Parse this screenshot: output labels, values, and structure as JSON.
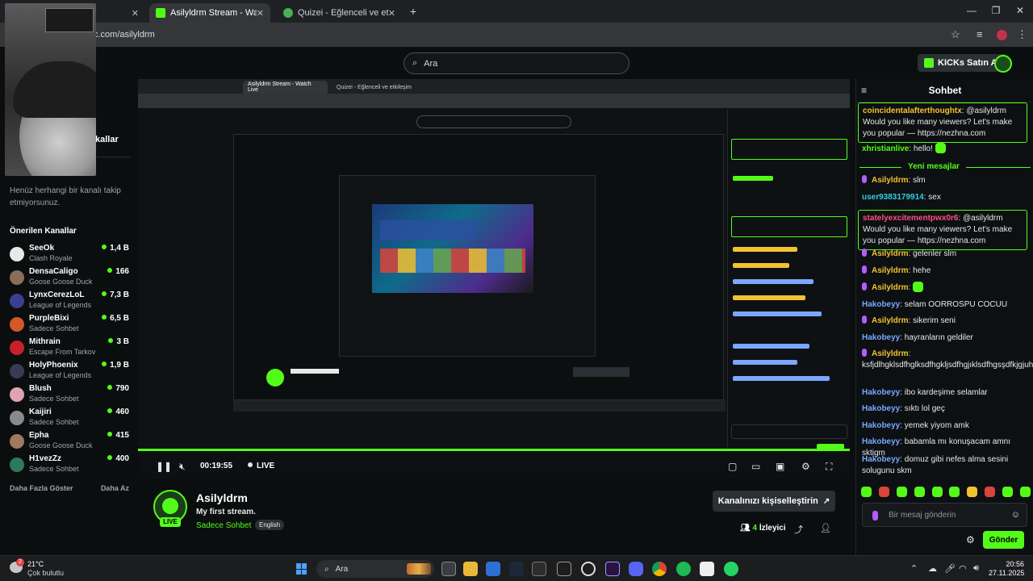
{
  "browser": {
    "tabs": [
      {
        "label": "",
        "active": false
      },
      {
        "label": "Asilyldrm Stream - Watch Live o",
        "active": true
      },
      {
        "label": "Quizei - Eğlenceli ve etkileşiml",
        "active": false
      }
    ],
    "url": "c.com/asilyldrm"
  },
  "header": {
    "search_placeholder": "Ara",
    "kicks_button": "KICKs Satın Al"
  },
  "sidebar": {
    "followed_title": "kallar",
    "no_follow_text": "Henüz herhangi bir kanalı takip etmiyorsunuz.",
    "recommended_title": "Önerilen Kanallar",
    "channels": [
      {
        "name": "SeeOk",
        "category": "Clash Royale",
        "viewers": "1,4 B",
        "color": "#e8e8e8"
      },
      {
        "name": "DensaCaligo",
        "category": "Goose Goose Duck",
        "viewers": "166",
        "color": "#8a6d5a"
      },
      {
        "name": "LynxCerezLoL",
        "category": "League of Legends",
        "viewers": "7,3 B",
        "color": "#3b3f8f"
      },
      {
        "name": "PurpleBixi",
        "category": "Sadece Sohbet",
        "viewers": "6,5 B",
        "color": "#d4572a"
      },
      {
        "name": "Mithrain",
        "category": "Escape From Tarkov",
        "viewers": "3 B",
        "color": "#c8202a"
      },
      {
        "name": "HolyPhoenix",
        "category": "League of Legends",
        "viewers": "1,9 B",
        "color": "#3a3a55"
      },
      {
        "name": "Blush",
        "category": "Sadece Sohbet",
        "viewers": "790",
        "color": "#e0a3b0"
      },
      {
        "name": "Kaijiri",
        "category": "Sadece Sohbet",
        "viewers": "460",
        "color": "#8a8a8a"
      },
      {
        "name": "Epha",
        "category": "Goose Goose Duck",
        "viewers": "415",
        "color": "#a07a60"
      },
      {
        "name": "H1vezZz",
        "category": "Sadece Sohbet",
        "viewers": "400",
        "color": "#2d7a5a"
      }
    ],
    "show_more": "Daha Fazla Göster",
    "show_less": "Daha Az"
  },
  "player": {
    "time": "00:19:55",
    "live": "LIVE",
    "nested_tabs": [
      "Asilyldrm Stream - Watch Live",
      "Quizei - Eğlenceli ve etkileşim"
    ]
  },
  "channel": {
    "name": "Asilyldrm",
    "title": "My first stream.",
    "category": "Sadece Sohbet",
    "language": "English",
    "live_badge": "LIVE",
    "customize_button": "Kanalınızı kişiselleştirin",
    "viewers_count": "4",
    "viewers_label": "İzleyici"
  },
  "chat": {
    "title": "Sohbet",
    "new_messages": "Yeni mesajlar",
    "messages": [
      {
        "user": "coincidentalafterthoughtx",
        "text": ": @asilyldrm Would you like many viewers? Let's make you popular — https://nezhna.com",
        "color": "#f1c232",
        "boxed": true
      },
      {
        "user": "xhristianlive",
        "text": ": hello!",
        "color": "#53fc18"
      },
      {
        "user": "Asilyldrm",
        "text": ": slm",
        "color": "#f1c232"
      },
      {
        "user": "user9383179914",
        "text": ": sex",
        "color": "#2fd0e0"
      },
      {
        "user": "statelyexcitementpwx0r6",
        "text": ": @asilyldrm Would you like many viewers? Let's make you popular — https://nezhna.com",
        "color": "#ff4f7a",
        "boxed": true
      },
      {
        "user": "Asilyldrm",
        "text": ": gelenler slm",
        "color": "#f1c232"
      },
      {
        "user": "Asilyldrm",
        "text": ": hehe",
        "color": "#f1c232"
      },
      {
        "user": "Asilyldrm",
        "text": ":",
        "color": "#f1c232"
      },
      {
        "user": "Hakobeyy",
        "text": ": selam OORROSPU COCUU",
        "color": "#7aa7ff"
      },
      {
        "user": "Asilyldrm",
        "text": ": sikerim seni",
        "color": "#f1c232"
      },
      {
        "user": "Hakobeyy",
        "text": ": hayranların geldiler",
        "color": "#7aa7ff"
      },
      {
        "user": "Asilyldrm",
        "text": ": ksfjdlhgklsdfhglksdfhgkljsdfhgjıklsdfhgsşdfkjgjuhsfdeg",
        "color": "#f1c232"
      },
      {
        "user": "Hakobeyy",
        "text": ": ibo kardeşime selamlar",
        "color": "#7aa7ff"
      },
      {
        "user": "Hakobeyy",
        "text": ": sıktı lol geç",
        "color": "#7aa7ff"
      },
      {
        "user": "Hakobeyy",
        "text": ": yemek yiyom amk",
        "color": "#7aa7ff"
      },
      {
        "user": "Hakobeyy",
        "text": ": babamla mı konuşacam amnı sktigm",
        "color": "#7aa7ff"
      },
      {
        "user": "Hakobeyy",
        "text": ": domuz gibi nefes alma sesini solugunu skm",
        "color": "#7aa7ff"
      }
    ],
    "input_placeholder": "Bir mesaj gönderin",
    "send_button": "Gönder"
  },
  "taskbar": {
    "temp": "21°C",
    "weather": "Çok bulutlu",
    "weather_badge": "2",
    "search_placeholder": "Ara",
    "time": "20:56",
    "date": "27.11.2025"
  },
  "colors": {
    "accent": "#53fc18",
    "background": "#0b0e0f"
  }
}
